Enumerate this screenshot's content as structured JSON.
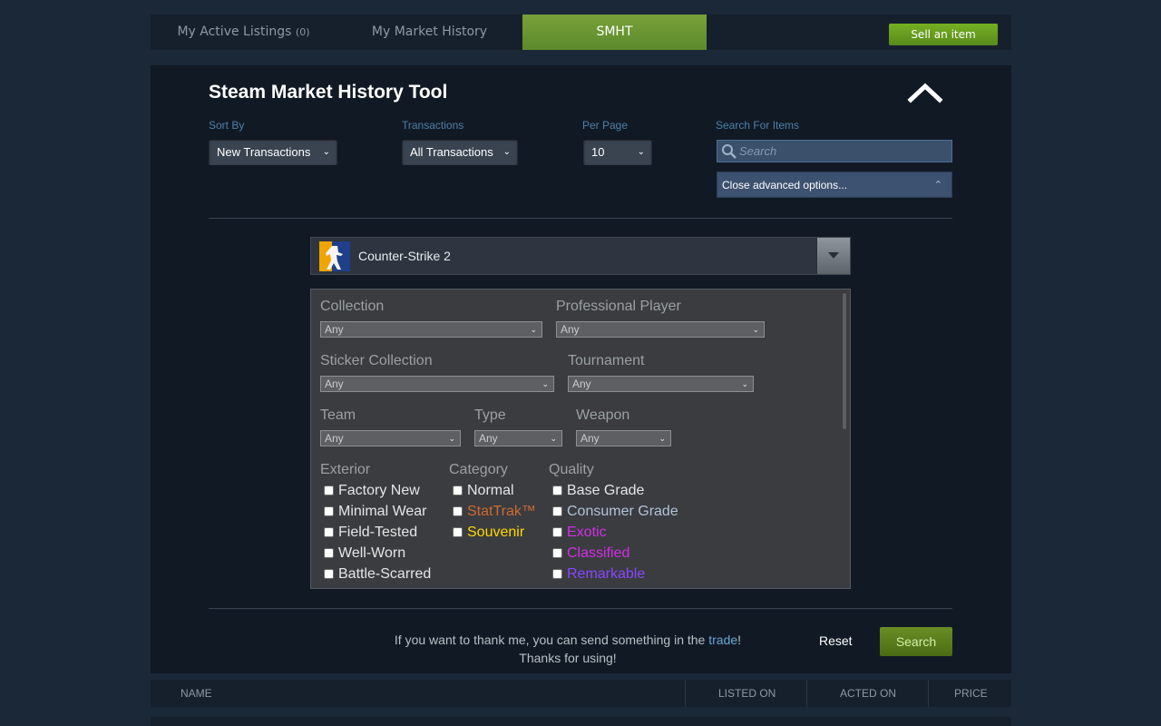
{
  "tabs": {
    "active_listings_label": "My Active Listings",
    "active_listings_count": "(0)",
    "history_label": "My Market History",
    "smht_label": "SMHT"
  },
  "sell_button": "Sell an item",
  "tool": {
    "title": "Steam Market History Tool",
    "sort_by": {
      "label": "Sort By",
      "value": "New Transactions"
    },
    "transactions": {
      "label": "Transactions",
      "value": "All Transactions"
    },
    "per_page": {
      "label": "Per Page",
      "value": "10"
    },
    "search": {
      "label": "Search For Items",
      "placeholder": "Search"
    },
    "advanced_toggle": "Close advanced options...",
    "game": "Counter-Strike 2"
  },
  "filters": {
    "collection": {
      "label": "Collection",
      "value": "Any"
    },
    "pro_player": {
      "label": "Professional Player",
      "value": "Any"
    },
    "sticker_collection": {
      "label": "Sticker Collection",
      "value": "Any"
    },
    "tournament": {
      "label": "Tournament",
      "value": "Any"
    },
    "team": {
      "label": "Team",
      "value": "Any"
    },
    "type": {
      "label": "Type",
      "value": "Any"
    },
    "weapon": {
      "label": "Weapon",
      "value": "Any"
    },
    "exterior": {
      "label": "Exterior",
      "options": [
        "Factory New",
        "Minimal Wear",
        "Field-Tested",
        "Well-Worn",
        "Battle-Scarred"
      ]
    },
    "category": {
      "label": "Category",
      "options": [
        "Normal",
        "StatTrak™",
        "Souvenir"
      ]
    },
    "quality": {
      "label": "Quality",
      "options": [
        "Base Grade",
        "Consumer Grade",
        "Exotic",
        "Classified",
        "Remarkable"
      ]
    }
  },
  "colors": {
    "normal": "#e6e6e6",
    "stattrak": "#cf6a32",
    "souvenir": "#ffd700",
    "base_grade": "#e6e6e6",
    "consumer_grade": "#b0c3d9",
    "exotic": "#d32ee6",
    "classified": "#d32ee6",
    "remarkable": "#8847ff"
  },
  "footer": {
    "thanks_pre": "If you want to thank me, you can send something in the ",
    "trade_link": "trade",
    "thanks_post": "!",
    "thanks_line2": "Thanks for using!",
    "reset": "Reset",
    "search": "Search"
  },
  "table": {
    "headers": [
      "NAME",
      "LISTED ON",
      "ACTED ON",
      "PRICE"
    ]
  }
}
